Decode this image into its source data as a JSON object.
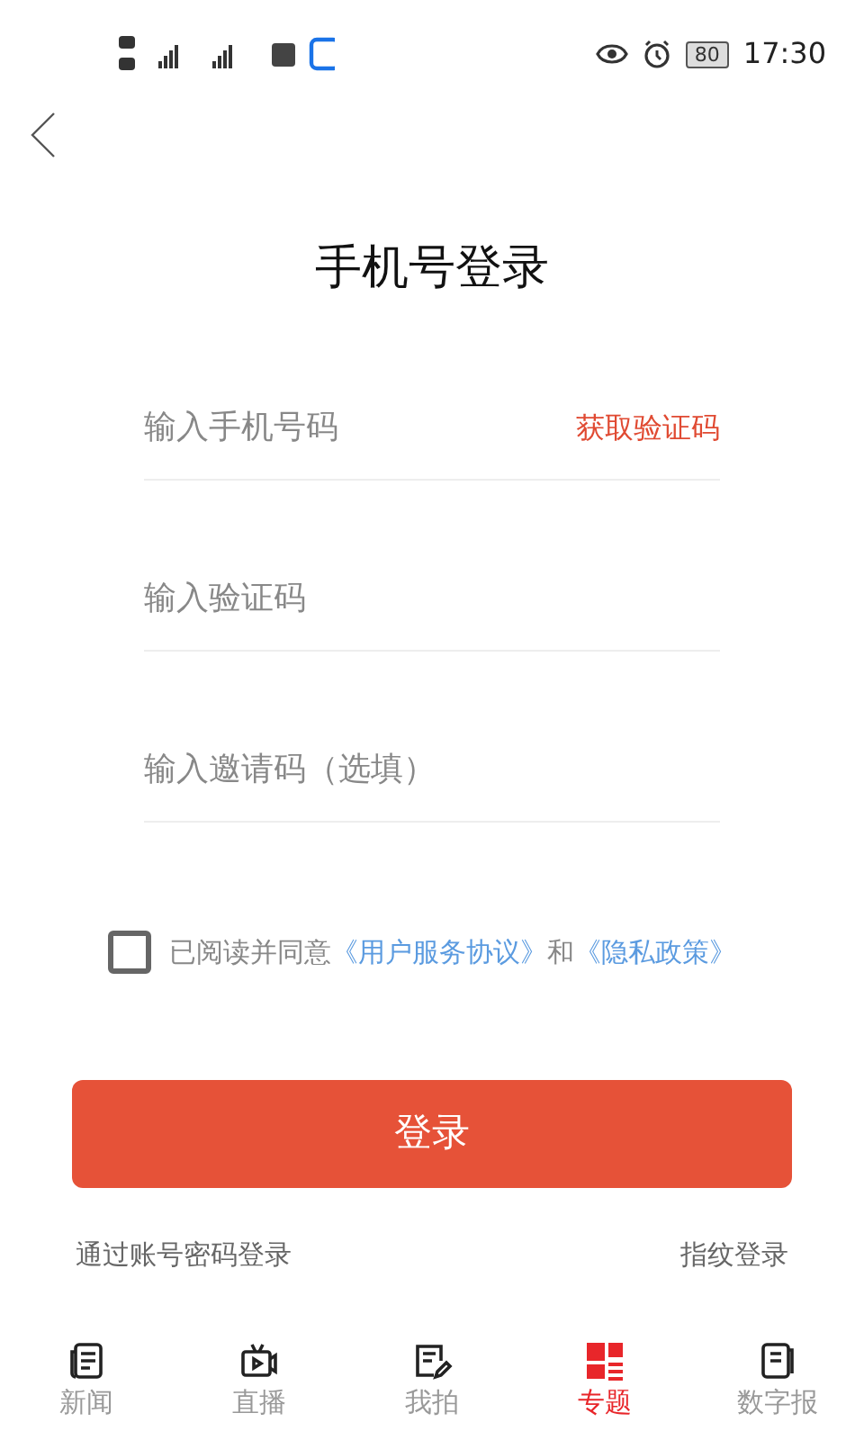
{
  "status_bar": {
    "battery": "80",
    "time": "17:30"
  },
  "title": "手机号登录",
  "fields": [
    {
      "placeholder": "输入手机号码",
      "action": "获取验证码"
    },
    {
      "placeholder": "输入验证码"
    },
    {
      "placeholder": "输入邀请码（选填）"
    }
  ],
  "agreement": {
    "checked": false,
    "parts": [
      {
        "kind": "text",
        "text": "已阅读并同意"
      },
      {
        "kind": "link",
        "text": "《用户服务协议》"
      },
      {
        "kind": "text",
        "text": "和"
      },
      {
        "kind": "link",
        "text": "《隐私政策》"
      }
    ]
  },
  "login_button": "登录",
  "alt_logins": [
    "通过账号密码登录",
    "指纹登录"
  ],
  "nav": [
    {
      "kind": "news",
      "label": "新闻",
      "selected": false
    },
    {
      "kind": "live",
      "label": "直播",
      "selected": false
    },
    {
      "kind": "shoot",
      "label": "我拍",
      "selected": false
    },
    {
      "kind": "topics",
      "label": "专题",
      "selected": true
    },
    {
      "kind": "paper",
      "label": "数字报",
      "selected": false
    }
  ]
}
